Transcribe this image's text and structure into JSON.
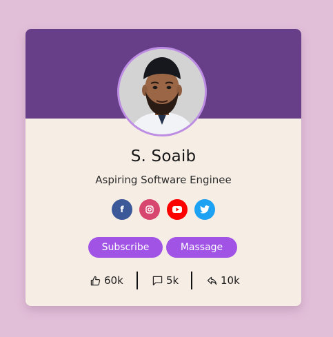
{
  "profile": {
    "name": "S. Soaib",
    "role": "Aspiring Software Enginee"
  },
  "socials": [
    {
      "icon": "facebook-icon",
      "color": "#3b5998",
      "glyph": "f"
    },
    {
      "icon": "instagram-icon",
      "color": "#d6466f"
    },
    {
      "icon": "youtube-icon",
      "color": "#ff0000"
    },
    {
      "icon": "twitter-icon",
      "color": "#1da1f2"
    }
  ],
  "actions": {
    "subscribe_label": "Subscribe",
    "message_label": "Massage"
  },
  "stats": {
    "likes": "60k",
    "comments": "5k",
    "shares": "10k"
  },
  "colors": {
    "background": "#e2bfd9",
    "header": "#663f88",
    "card": "#f6ede4",
    "button": "#a153e6",
    "avatar_border": "#bd8ce3"
  }
}
